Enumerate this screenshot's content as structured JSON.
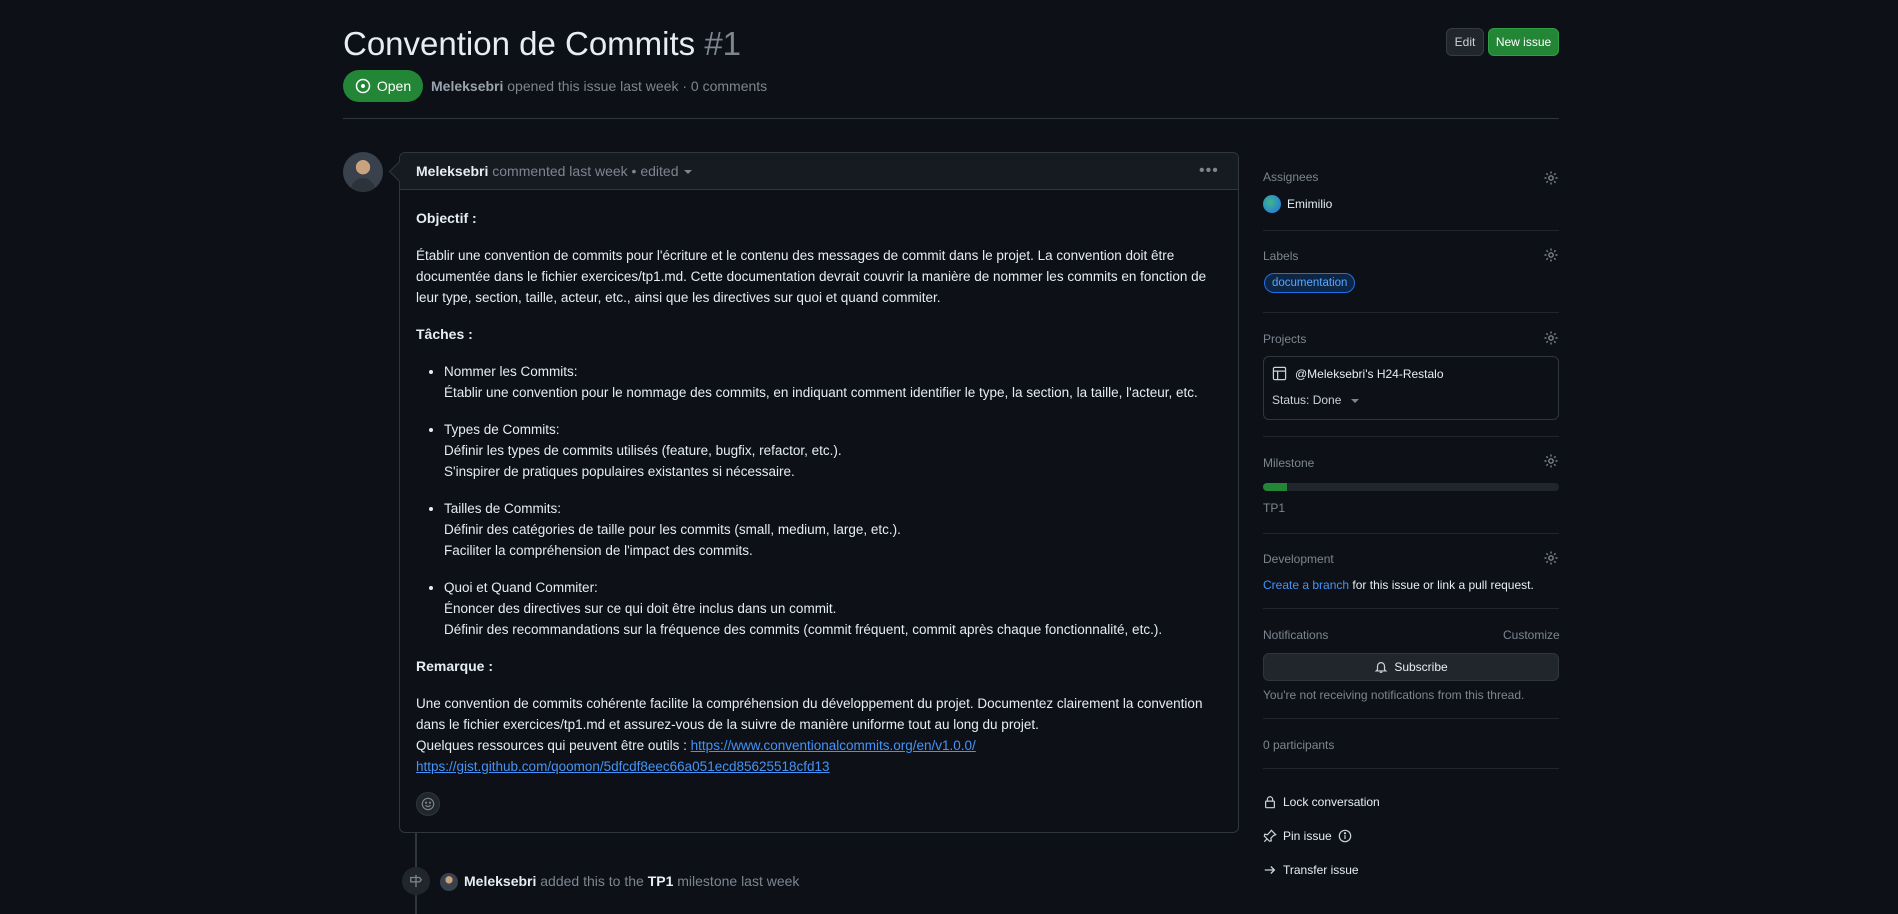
{
  "header": {
    "title": "Convention de Commits",
    "number": "#1",
    "edit_label": "Edit",
    "new_issue_label": "New issue",
    "state_label": "Open",
    "author": "Meleksebri",
    "meta_text": "opened this issue last week · 0 comments"
  },
  "comment": {
    "author": "Meleksebri",
    "meta": "commented last week • edited",
    "menu_icon": "kebab-horizontal-icon",
    "objective_heading": "Objectif :",
    "objective_text": "Établir une convention de commits pour l'écriture et le contenu des messages de commit dans le projet. La convention doit être documentée dans le fichier exercices/tp1.md. Cette documentation devrait couvrir la manière de nommer les commits en fonction de leur type, section, taille, acteur, etc., ainsi que les directives sur quoi et quand commiter.",
    "tasks_heading": "Tâches :",
    "tasks": [
      {
        "title": "Nommer les Commits:",
        "lines": [
          "Établir une convention pour le nommage des commits, en indiquant comment identifier le type, la section, la taille, l'acteur, etc."
        ]
      },
      {
        "title": "Types de Commits:",
        "lines": [
          "Définir les types de commits utilisés (feature, bugfix, refactor, etc.).",
          "S'inspirer de pratiques populaires existantes si nécessaire."
        ]
      },
      {
        "title": "Tailles de Commits:",
        "lines": [
          "Définir des catégories de taille pour les commits (small, medium, large, etc.).",
          "Faciliter la compréhension de l'impact des commits."
        ]
      },
      {
        "title": "Quoi et Quand Commiter:",
        "lines": [
          "Énoncer des directives sur ce qui doit être inclus dans un commit.",
          "Définir des recommandations sur la fréquence des commits (commit fréquent, commit après chaque fonctionnalité, etc.)."
        ]
      }
    ],
    "remark_heading": "Remarque :",
    "remark_text": "Une convention de commits cohérente facilite la compréhension du développement du projet. Documentez clairement la convention dans le fichier exercices/tp1.md et assurez-vous de la suivre de manière uniforme tout au long du projet.",
    "resources_label": "Quelques ressources qui peuvent être outils :",
    "link1": "https://www.conventionalcommits.org/en/v1.0.0/",
    "link2": "https://gist.github.com/qoomon/5dfcdf8eec66a051ecd85625518cfd13",
    "reaction_icon": "smiley-icon"
  },
  "timeline_event": {
    "icon": "milestone-icon",
    "author": "Meleksebri",
    "text_before": "added this to the",
    "milestone": "TP1",
    "text_after": "milestone last week"
  },
  "sidebar": {
    "assignees_label": "Assignees",
    "assignee": "Emimilio",
    "labels_label": "Labels",
    "label": "documentation",
    "projects_label": "Projects",
    "project_name": "@Meleksebri's H24-Restalo",
    "project_status": "Status: Done",
    "milestone_label": "Milestone",
    "milestone_progress": 0.08,
    "milestone_name": "TP1",
    "development_label": "Development",
    "create_branch": "Create a branch",
    "development_text": "for this issue or link a pull request.",
    "notifications_label": "Notifications",
    "customize_label": "Customize",
    "subscribe_label": "Subscribe",
    "notif_note": "You're not receiving notifications from this thread.",
    "participants": "0 participants",
    "lock_label": "Lock conversation",
    "pin_label": "Pin issue",
    "transfer_label": "Transfer issue"
  },
  "colors": {
    "background": "#0d1117",
    "accent_green": "#238636",
    "link_blue": "#4493f8",
    "muted": "#7d8590"
  }
}
